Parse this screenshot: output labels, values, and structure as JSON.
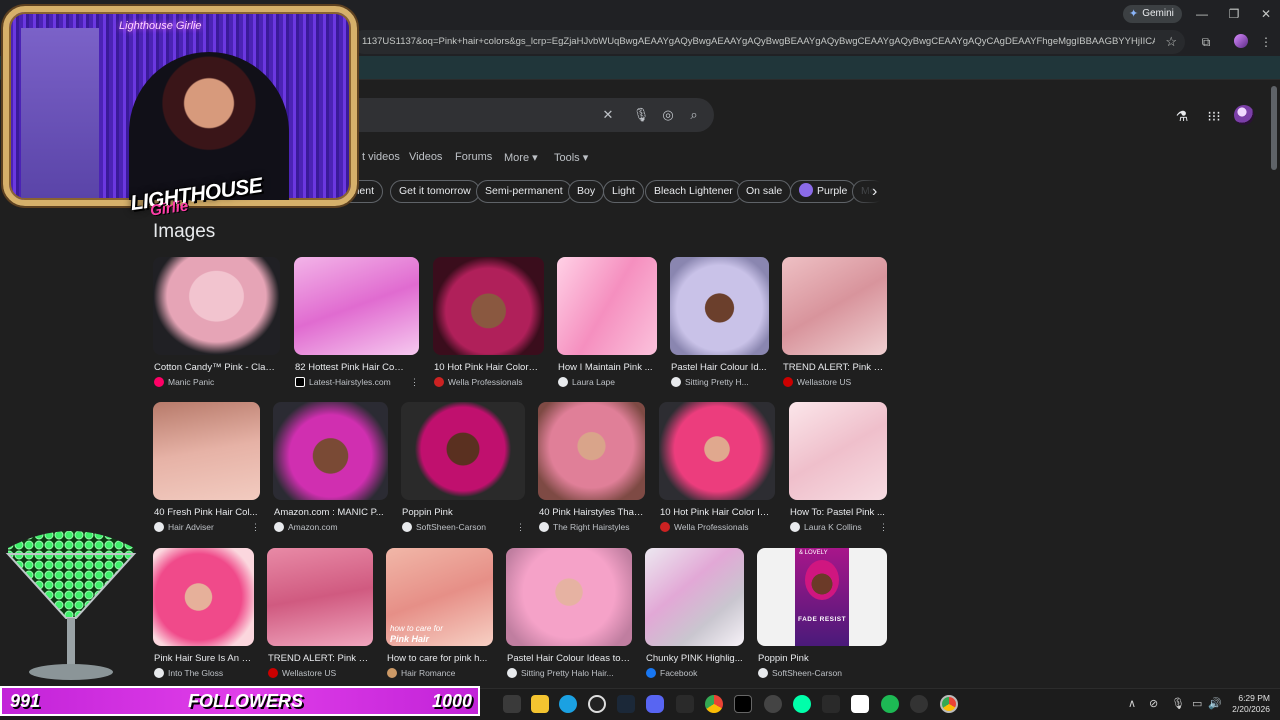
{
  "browser": {
    "gemini_label": "Gemini",
    "url": "1137US1137&oq=Pink+hair+colors&gs_lcrp=EgZjaHJvbWUqBwgAEAAYgAQyBwgAEAAYgAQyBwgBEAAYgAQyBwgCEAAYgAQyBwgCEAAYgAQyCAgDEAAYFhgeMggIBBAAGBYYHjIICAUQABgWGB4yCAgGEAAYFh...",
    "bookmark_star": "☆"
  },
  "search": {
    "tabs": [
      "t videos",
      "Videos",
      "Forums",
      "More ▾",
      "Tools ▾"
    ],
    "chips": [
      "manent",
      "Get it tomorrow",
      "Semi-permanent",
      "Boy",
      "Light",
      "Bleach Lightener",
      "On sale",
      "Purple",
      "Me"
    ]
  },
  "images_heading": "Images",
  "images": [
    {
      "title": "Cotton Candy™ Pink - Classi...",
      "source": "Manic Panic"
    },
    {
      "title": "82 Hottest Pink Hair Color I...",
      "source": "Latest-Hairstyles.com"
    },
    {
      "title": "10 Hot Pink Hair Color I...",
      "source": "Wella Professionals"
    },
    {
      "title": "How I Maintain Pink ...",
      "source": "Laura Lape"
    },
    {
      "title": "Pastel Hair Colour Id...",
      "source": "Sitting Pretty H..."
    },
    {
      "title": "TREND ALERT: Pink Ha...",
      "source": "Wellastore US"
    },
    {
      "title": "40 Fresh Pink Hair Col...",
      "source": "Hair Adviser"
    },
    {
      "title": "Amazon.com : MANIC P...",
      "source": "Amazon.com"
    },
    {
      "title": "Poppin Pink",
      "source": "SoftSheen-Carson"
    },
    {
      "title": "40 Pink Hairstyles That...",
      "source": "The Right Hairstyles"
    },
    {
      "title": "10 Hot Pink Hair Color Id...",
      "source": "Wella Professionals"
    },
    {
      "title": "How To: Pastel Pink ...",
      "source": "Laura K Collins"
    },
    {
      "title": "Pink Hair Sure Is An I...",
      "source": "Into The Gloss"
    },
    {
      "title": "TREND ALERT: Pink Ha...",
      "source": "Wellastore US"
    },
    {
      "title": "How to care for pink h...",
      "source": "Hair Romance"
    },
    {
      "title": "Pastel Hair Colour Ideas to ...",
      "source": "Sitting Pretty Halo Hair..."
    },
    {
      "title": "Chunky PINK Highlig...",
      "source": "Facebook"
    },
    {
      "title": "Poppin Pink",
      "source": "SoftSheen-Carson"
    }
  ],
  "overlay": {
    "cam_neon": "Lighthouse Girlie",
    "logo_main": "LIGHTHOUSE",
    "logo_sub": "Girlie",
    "followers_current": "991",
    "followers_label": "FOLLOWERS",
    "followers_goal": "1000",
    "goal_progress": 0.991
  },
  "thumb_text": {
    "care_caption": "how to care for",
    "care_caption2": "Pink Hair",
    "box_brand": "& LOVELY",
    "box_name": "FADE RESIST"
  },
  "clock": {
    "time": "6:29 PM",
    "date": "2/20/2026"
  },
  "colors": {
    "accent_pink": "#e03ee9",
    "chip_purple": "#8b6be8",
    "frame_gold": "#d6b06a"
  }
}
